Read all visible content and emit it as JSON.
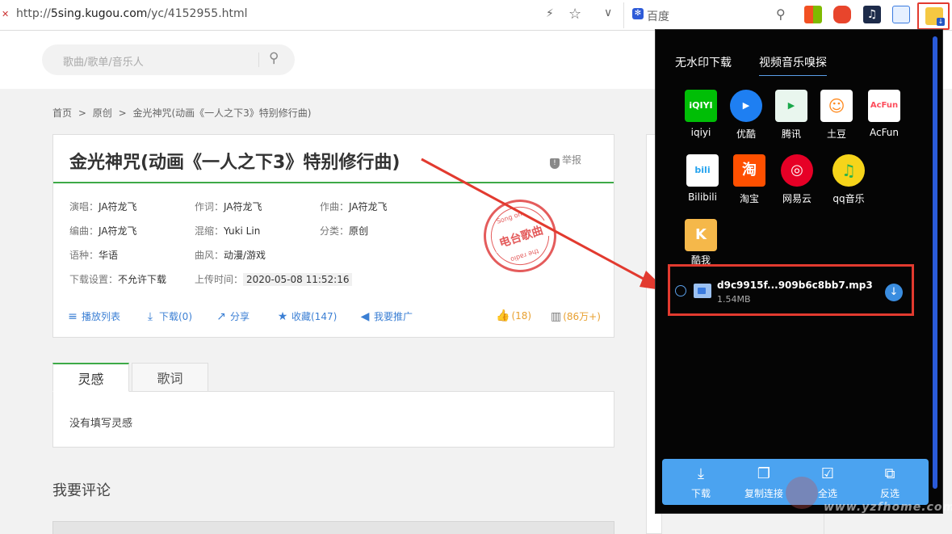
{
  "browser": {
    "url_prefix": "http://",
    "url_host": "5sing.kugou.com",
    "url_path": "/yc/4152955.html",
    "search_engine": "百度"
  },
  "site": {
    "search_placeholder": "歌曲/歌单/音乐人"
  },
  "breadcrumb": [
    "首页",
    ">",
    "原创",
    ">",
    "金光神咒(动画《一人之下3》特别修行曲)"
  ],
  "song": {
    "title": "金光神咒(动画《一人之下3》特别修行曲)",
    "report": "举报",
    "singer_label": "演唱：",
    "singer": "JA符龙飞",
    "lyricist_label": "作词：",
    "lyricist": "JA符龙飞",
    "composer_label": "作曲：",
    "composer": "JA符龙飞",
    "arranger_label": "编曲：",
    "arranger": "JA符龙飞",
    "mix_label": "混缩：",
    "mix": "Yuki Lin",
    "category_label": "分类：",
    "category": "原创",
    "language_label": "语种：",
    "language": "华语",
    "style_label": "曲风：",
    "style": "动漫/游戏",
    "download_label": "下载设置：",
    "download": "不允许下载",
    "upload_label": "上传时间：",
    "upload": "2020-05-08 11:52:16",
    "stamp_main": "电台歌曲",
    "stamp_top": "Song on",
    "stamp_bottom": "the radio"
  },
  "actions": {
    "playlist": "播放列表",
    "download": "下载(0)",
    "share": "分享",
    "collect": "收藏(147)",
    "promote": "我要推广",
    "likes": "(18)",
    "plays": "(86万+)"
  },
  "tabs": {
    "inspiration": "灵感",
    "lyrics": "歌词",
    "inspiration_text": "没有填写灵感"
  },
  "comments": {
    "heading": "我要评论"
  },
  "popup": {
    "tab_nowatermark": "无水印下载",
    "tab_sniff": "视频音乐嗅探",
    "sites": [
      {
        "name": "iqiyi",
        "color": "#00be06",
        "mark": "iQIYI"
      },
      {
        "name": "优酷",
        "color": "#1e7ff2",
        "mark": "▶"
      },
      {
        "name": "腾讯",
        "color": "#f0f8ff",
        "mark": "▶"
      },
      {
        "name": "土豆",
        "color": "#ff8a1f",
        "mark": "☺"
      },
      {
        "name": "AcFun",
        "color": "#fd4c5b",
        "mark": "AcFun"
      },
      {
        "name": "Bilibili",
        "color": "#23a2ee",
        "mark": "bili"
      },
      {
        "name": "淘宝",
        "color": "#ff5000",
        "mark": "淘"
      },
      {
        "name": "网易云",
        "color": "#e60026",
        "mark": "◎"
      },
      {
        "name": "qq音乐",
        "color": "#f6d41a",
        "mark": "♫"
      },
      {
        "name": "酷我",
        "color": "#f5b84a",
        "mark": "K"
      }
    ],
    "file_name": "d9c9915f...909b6c8bb7.mp3",
    "file_size": "1.54MB",
    "footer": {
      "download": "下载",
      "copy": "复制连接",
      "select_all": "全选",
      "invert": "反选"
    }
  },
  "watermark": "www.yzfhome.com",
  "colors": {
    "accent_green": "#3daa47",
    "link_blue": "#3b7fd4",
    "annotation_red": "#e23a2f",
    "popup_bg": "#050505",
    "popup_footer": "#4ba3f0"
  }
}
